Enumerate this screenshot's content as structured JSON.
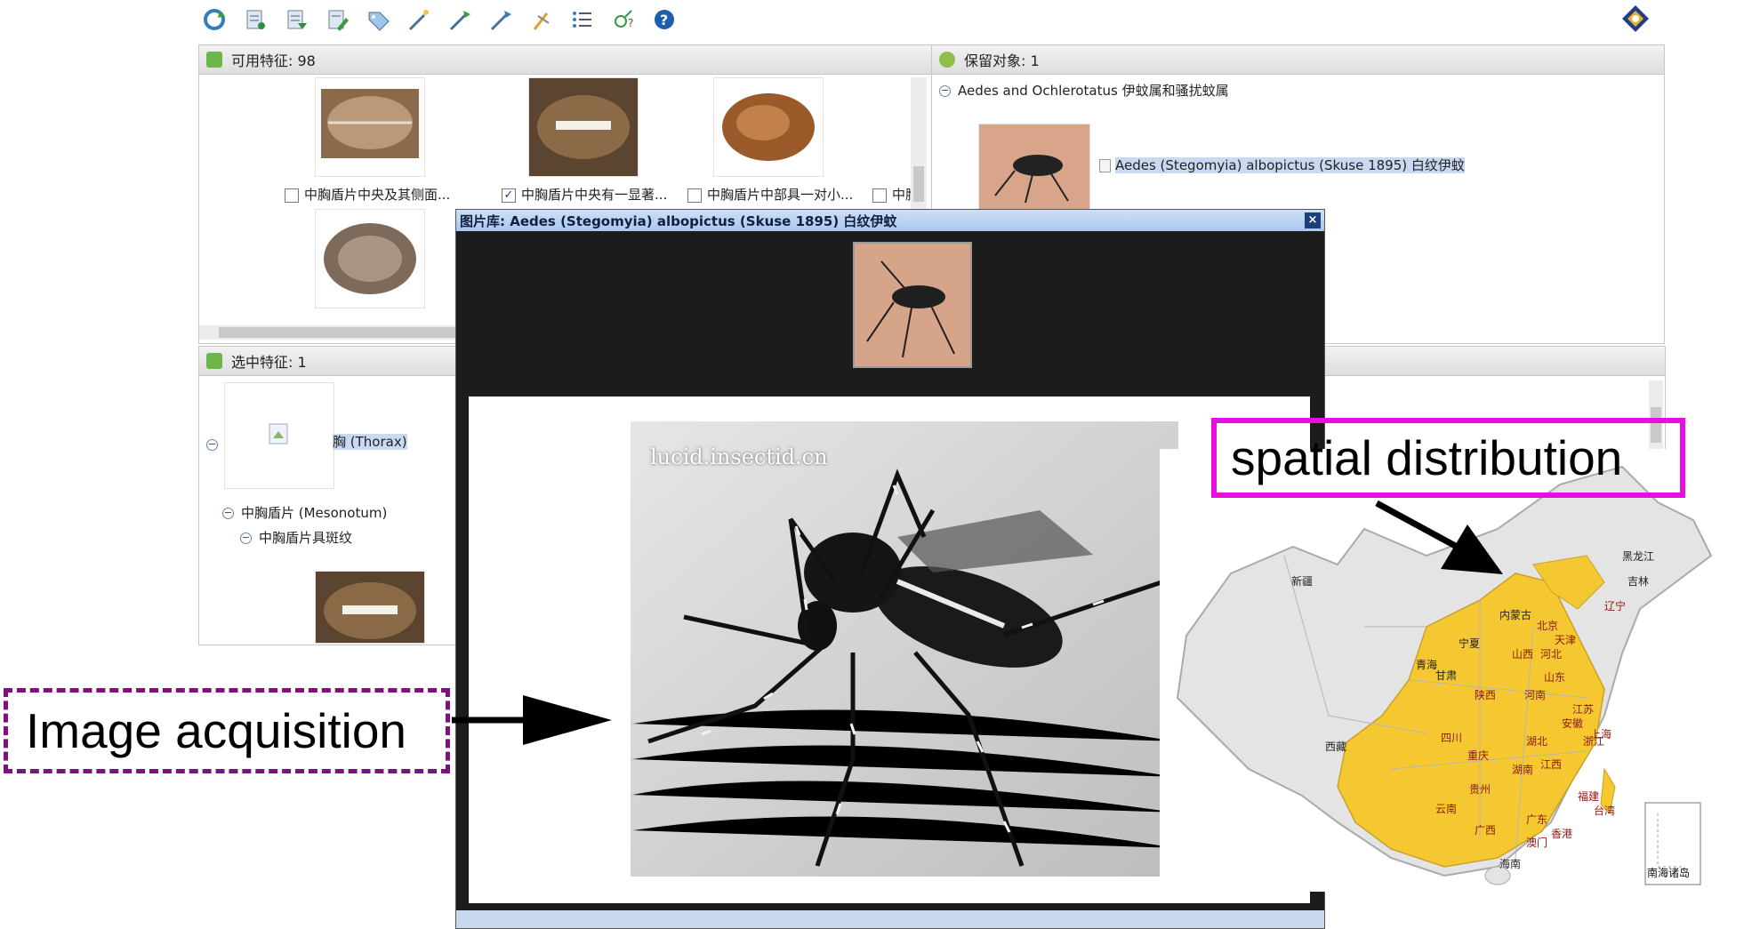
{
  "toolbar": {
    "icons": [
      "refresh-icon",
      "list-icon",
      "tree-icon",
      "edit-icon",
      "tag-icon",
      "wand-icon",
      "wand-two-icon",
      "wand-three-icon",
      "wand-four-icon",
      "checklist-icon",
      "gender-icon",
      "help-icon"
    ]
  },
  "available_features": {
    "title": "可用特征: 98",
    "items": [
      {
        "caption": "中胸盾片中央及其侧面...",
        "checked": false
      },
      {
        "caption": "中胸盾片中央有一显著...",
        "checked": true
      },
      {
        "caption": "中胸盾片中部具一对小...",
        "checked": false
      },
      {
        "caption": "中胸",
        "checked": false
      }
    ]
  },
  "retained_objects": {
    "title": "保留对象: 1",
    "group": "Aedes and Ochlerotatus 伊蚊属和骚扰蚊属",
    "taxon": "Aedes (Stegomyia) albopictus (Skuse 1895) 白纹伊蚊"
  },
  "selected_features": {
    "title": "选中特征: 1",
    "nodes": [
      "胸 (Thorax)",
      "中胸盾片 (Mesonotum)",
      "中胸盾片具斑纹"
    ]
  },
  "dialog": {
    "title": "图片库: Aedes (Stegomyia) albopictus (Skuse 1895) 白纹伊蚊",
    "close": "×",
    "watermark": "lucid.insectid.cn"
  },
  "map": {
    "regions": [
      {
        "name": "黑龙江",
        "highlighted": false
      },
      {
        "name": "吉林",
        "highlighted": false
      },
      {
        "name": "辽宁",
        "highlighted": true
      },
      {
        "name": "新疆",
        "highlighted": false
      },
      {
        "name": "内蒙古",
        "highlighted": false
      },
      {
        "name": "北京",
        "highlighted": true
      },
      {
        "name": "天津",
        "highlighted": true
      },
      {
        "name": "宁夏",
        "highlighted": false
      },
      {
        "name": "山西",
        "highlighted": true
      },
      {
        "name": "河北",
        "highlighted": true
      },
      {
        "name": "山东",
        "highlighted": true
      },
      {
        "name": "青海",
        "highlighted": false
      },
      {
        "name": "甘肃",
        "highlighted": false
      },
      {
        "name": "陕西",
        "highlighted": true
      },
      {
        "name": "河南",
        "highlighted": true
      },
      {
        "name": "西藏",
        "highlighted": false
      },
      {
        "name": "四川",
        "highlighted": true
      },
      {
        "name": "安徽",
        "highlighted": true
      },
      {
        "name": "江苏",
        "highlighted": true
      },
      {
        "name": "上海",
        "highlighted": true
      },
      {
        "name": "重庆",
        "highlighted": true
      },
      {
        "name": "湖北",
        "highlighted": true
      },
      {
        "name": "浙江",
        "highlighted": true
      },
      {
        "name": "江西",
        "highlighted": true
      },
      {
        "name": "湖南",
        "highlighted": true
      },
      {
        "name": "贵州",
        "highlighted": true
      },
      {
        "name": "福建",
        "highlighted": true
      },
      {
        "name": "云南",
        "highlighted": true
      },
      {
        "name": "台湾",
        "highlighted": true
      },
      {
        "name": "广东",
        "highlighted": true
      },
      {
        "name": "广西",
        "highlighted": true
      },
      {
        "name": "澳门",
        "highlighted": true
      },
      {
        "name": "香港",
        "highlighted": true
      },
      {
        "name": "海南",
        "highlighted": false
      }
    ],
    "inset": "南海诸岛",
    "highlight_color": "#f5c832",
    "base_color": "#e4e4e4"
  },
  "annotations": {
    "spatial": "spatial distribution",
    "image": "Image acquisition",
    "spatial_color": "#e50fe0",
    "image_color": "#800f80"
  }
}
